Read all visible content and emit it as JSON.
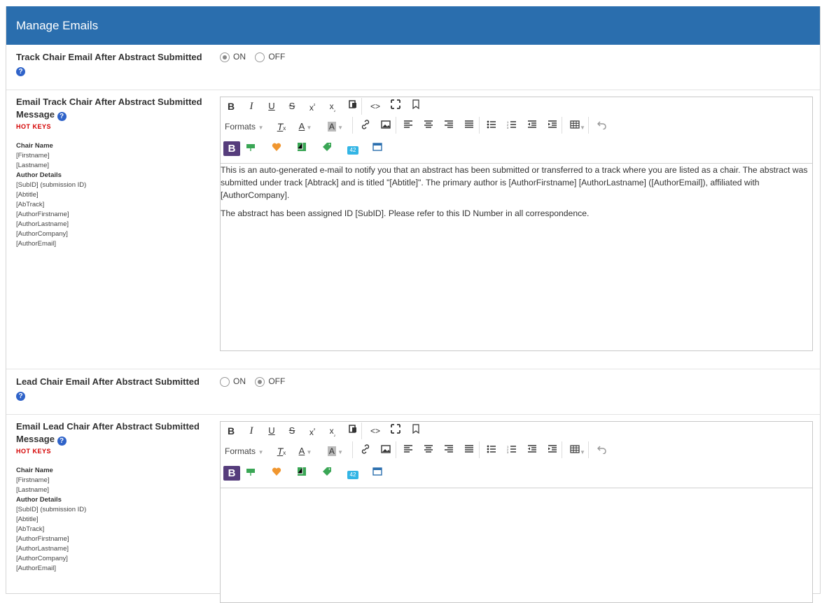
{
  "header": {
    "title": "Manage Emails"
  },
  "sections": [
    {
      "toggle_label": "Track Chair Email After Abstract Submitted",
      "on_label": "ON",
      "off_label": "OFF",
      "selected": "ON",
      "message_label_line1": "Email Track Chair After Abstract Submitted",
      "message_label_line2": "Message",
      "hot_keys_label": "HOT KEYS",
      "hot_keys": [
        "Chair Name",
        "[Firstname]",
        "[Lastname]",
        "Author Details",
        "[SubID] (submission ID)",
        "[Abtitle]",
        "[AbTrack]",
        "[AuthorFirstname]",
        "[AuthorLastname]",
        "[AuthorCompany]",
        "[AuthorEmail]"
      ],
      "editor_paragraphs": [
        "This is an auto-generated e-mail to notify you that an abstract has been submitted or transferred to a track where you are listed as a chair. The abstract was submitted under track [Abtrack] and is titled \"[Abtitle]\". The primary author is [AuthorFirstname] [AuthorLastname] ([AuthorEmail]), affiliated with [AuthorCompany].",
        "The abstract has been assigned ID [SubID]. Please refer to this ID Number in all correspondence."
      ]
    },
    {
      "toggle_label": "Lead Chair Email After Abstract Submitted",
      "on_label": "ON",
      "off_label": "OFF",
      "selected": "OFF",
      "message_label_line1": "Email Lead Chair After Abstract Submitted",
      "message_label_line2": "Message",
      "hot_keys_label": "HOT KEYS",
      "hot_keys": [
        "Chair Name",
        "[Firstname]",
        "[Lastname]",
        "Author Details",
        "[SubID] (submission ID)",
        "[Abtitle]",
        "[AbTrack]",
        "[AuthorFirstname]",
        "[AuthorLastname]",
        "[AuthorCompany]",
        "[AuthorEmail]"
      ],
      "editor_paragraphs": []
    }
  ],
  "toolbar": {
    "formats_label": "Formats",
    "help_glyph": "?",
    "bootstrap_glyph": "B",
    "counter_glyph": "42",
    "row1_icons": [
      "bold-icon",
      "italic-icon",
      "underline-icon",
      "strikethrough-icon",
      "superscript-icon",
      "subscript-icon",
      "paste-icon",
      "code-icon",
      "fullscreen-icon",
      "bookmark-icon"
    ],
    "row2_icons": [
      "clear-format-icon",
      "text-color-icon",
      "bg-color-icon",
      "link-icon",
      "image-icon",
      "align-left-icon",
      "align-center-icon",
      "align-right-icon",
      "justify-icon",
      "bullet-list-icon",
      "numbered-list-icon",
      "outdent-icon",
      "indent-icon",
      "table-icon",
      "undo-icon"
    ],
    "row3_icons": [
      "bootstrap-icon",
      "button-icon",
      "heart-icon",
      "layout-icon",
      "tag-icon",
      "counter-icon",
      "panel-icon"
    ]
  }
}
